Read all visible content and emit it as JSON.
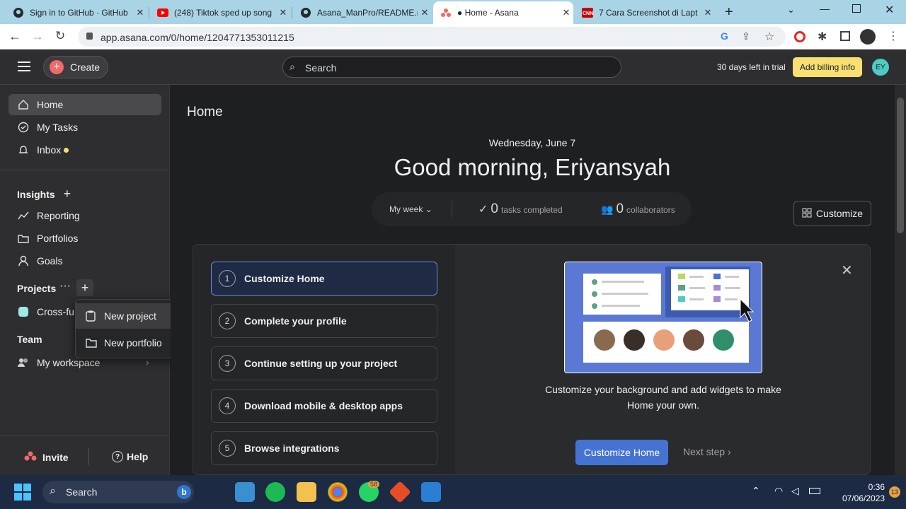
{
  "browser": {
    "tabs": [
      {
        "title": "Sign in to GitHub · GitHub",
        "favicon": "github-icon",
        "active": false
      },
      {
        "title": "(248) Tiktok sped up song",
        "favicon": "youtube-icon",
        "active": false
      },
      {
        "title": "Asana_ManPro/README.m",
        "favicon": "github-icon",
        "active": false
      },
      {
        "title": "● Home - Asana",
        "favicon": "asana-icon",
        "active": true
      },
      {
        "title": "7 Cara Screenshot di Lapt",
        "favicon": "cnn-icon",
        "active": false
      }
    ],
    "url": "app.asana.com/0/home/1204771353011215"
  },
  "topbar": {
    "create_label": "Create",
    "search_placeholder": "Search",
    "trial_text": "30 days left in trial",
    "billing_label": "Add billing info",
    "avatar_initials": "EY"
  },
  "sidebar": {
    "nav": [
      {
        "label": "Home",
        "icon": "home-icon"
      },
      {
        "label": "My Tasks",
        "icon": "check-circle-icon"
      },
      {
        "label": "Inbox",
        "icon": "bell-icon"
      }
    ],
    "insights_heading": "Insights",
    "insights": [
      {
        "label": "Reporting",
        "icon": "chart-line-icon"
      },
      {
        "label": "Portfolios",
        "icon": "folder-icon"
      },
      {
        "label": "Goals",
        "icon": "person-icon"
      }
    ],
    "projects_heading": "Projects",
    "project_item": "Cross-fu",
    "team_heading": "Team",
    "workspace_label": "My workspace",
    "invite_label": "Invite",
    "help_label": "Help"
  },
  "project_menu": {
    "items": [
      {
        "label": "New project",
        "icon": "clipboard-icon"
      },
      {
        "label": "New portfolio",
        "icon": "folder-icon"
      }
    ]
  },
  "main": {
    "page_title": "Home",
    "date": "Wednesday, June 7",
    "greeting": "Good morning, Eriyansyah",
    "period": "My week",
    "tasks_count": "0",
    "tasks_label": "tasks completed",
    "collab_count": "0",
    "collab_label": "collaborators",
    "customize_label": "Customize"
  },
  "onboarding": {
    "steps": [
      {
        "num": "1",
        "label": "Customize Home"
      },
      {
        "num": "2",
        "label": "Complete your profile"
      },
      {
        "num": "3",
        "label": "Continue setting up your project"
      },
      {
        "num": "4",
        "label": "Download mobile & desktop apps"
      },
      {
        "num": "5",
        "label": "Browse integrations"
      }
    ],
    "description": "Customize your background and add widgets to make Home your own.",
    "primary_label": "Customize Home",
    "next_label": "Next step"
  },
  "taskbar": {
    "search_label": "Search",
    "whatsapp_badge": "58",
    "notif_badge": "13",
    "time": "0:36",
    "date": "07/06/2023"
  },
  "colors": {
    "accent": "#4573d2",
    "billing": "#f8df72",
    "create": "#f06a6a"
  }
}
